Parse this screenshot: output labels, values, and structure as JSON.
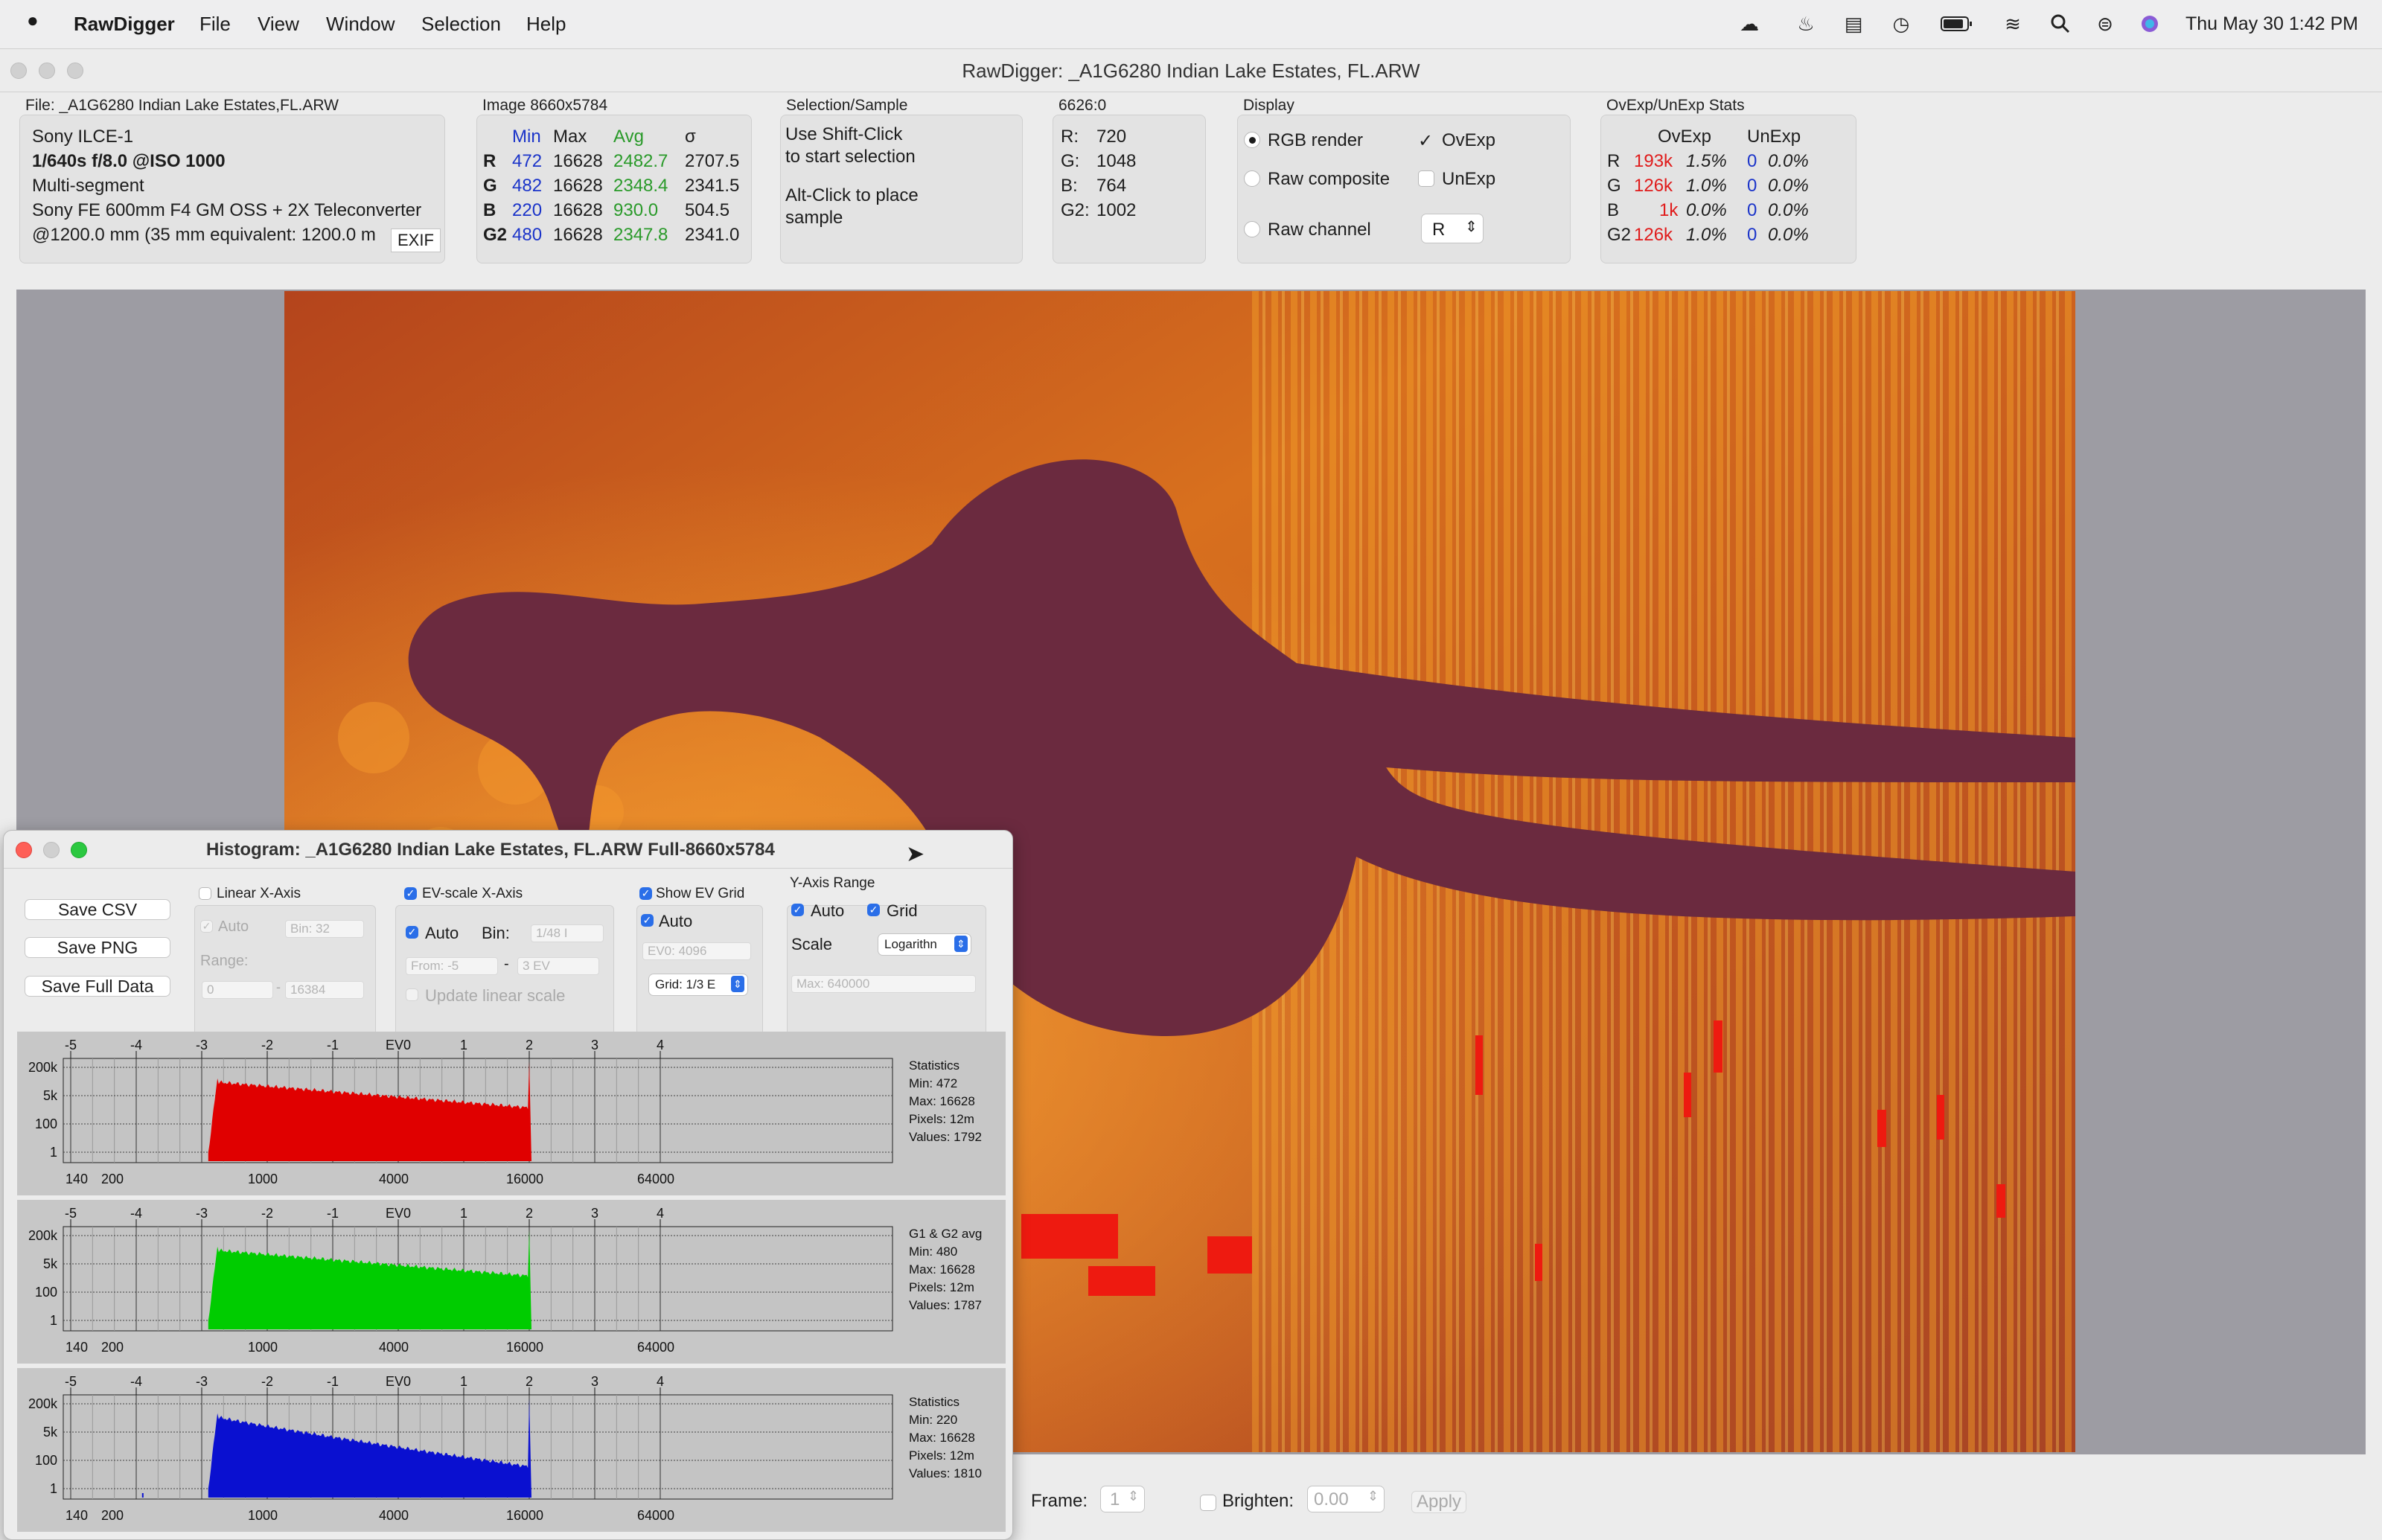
{
  "menubar": {
    "app": "RawDigger",
    "items": [
      "File",
      "View",
      "Window",
      "Selection",
      "Help"
    ],
    "clock": "Thu May 30  1:42 PM"
  },
  "window": {
    "title": "RawDigger: _A1G6280 Indian Lake Estates, FL.ARW"
  },
  "file": {
    "label": "File: _A1G6280 Indian Lake Estates,FL.ARW",
    "camera": "Sony ILCE-1",
    "exposure": "1/640s f/8.0 @ISO 1000",
    "mode": "Multi-segment",
    "lens": "Sony FE 600mm F4 GM OSS + 2X Teleconverter",
    "focal": "@1200.0 mm (35 mm equivalent: 1200.0 m",
    "exif": "EXIF"
  },
  "image": {
    "label": "Image 8660x5784",
    "headers": [
      "Min",
      "Max",
      "Avg",
      "σ"
    ],
    "rows": [
      {
        "ch": "R",
        "min": "472",
        "max": "16628",
        "avg": "2482.7",
        "sd": "2707.5"
      },
      {
        "ch": "G",
        "min": "482",
        "max": "16628",
        "avg": "2348.4",
        "sd": "2341.5"
      },
      {
        "ch": "B",
        "min": "220",
        "max": "16628",
        "avg": "930.0",
        "sd": "504.5"
      },
      {
        "ch": "G2",
        "min": "480",
        "max": "16628",
        "avg": "2347.8",
        "sd": "2341.0"
      }
    ]
  },
  "selection": {
    "label": "Selection/Sample",
    "line1": "Use Shift-Click",
    "line2": "to start selection",
    "line3": "Alt-Click to place",
    "line4": "sample"
  },
  "sample": {
    "label": "6626:0",
    "rows": [
      {
        "k": "R:",
        "v": "720"
      },
      {
        "k": "G:",
        "v": "1048"
      },
      {
        "k": "B:",
        "v": "764"
      },
      {
        "k": "G2:",
        "v": "1002"
      }
    ]
  },
  "display": {
    "label": "Display",
    "rgb": "RGB render",
    "rawcomp": "Raw composite",
    "rawch": "Raw channel",
    "ovexp": "OvExp",
    "unexp": "UnExp",
    "channel": "R"
  },
  "stats": {
    "label": "OvExp/UnExp Stats",
    "h1": "OvExp",
    "h2": "UnExp",
    "rows": [
      {
        "ch": "R",
        "ov": "193k",
        "ovp": "1.5%",
        "un": "0",
        "unp": "0.0%"
      },
      {
        "ch": "G",
        "ov": "126k",
        "ovp": "1.0%",
        "un": "0",
        "unp": "0.0%"
      },
      {
        "ch": "B",
        "ov": "1k",
        "ovp": "0.0%",
        "un": "0",
        "unp": "0.0%"
      },
      {
        "ch": "G2",
        "ov": "126k",
        "ovp": "1.0%",
        "un": "0",
        "unp": "0.0%"
      }
    ]
  },
  "bottom": {
    "frame": "Frame:",
    "frame_val": "1",
    "brighten": "Brighten:",
    "brighten_val": "0.00",
    "apply": "Apply"
  },
  "histogram": {
    "title": "Histogram: _A1G6280 Indian Lake Estates, FL.ARW Full-8660x5784",
    "save_csv": "Save CSV",
    "save_png": "Save PNG",
    "save_full": "Save Full Data",
    "linear": "Linear X-Axis",
    "auto": "Auto",
    "bin_ph": "Bin: 32",
    "range": "Range:",
    "r0": "0",
    "r1": "16384",
    "ev": "EV-scale X-Axis",
    "bin": "Bin:",
    "bin_val": "1/48 I",
    "from": "From: -5",
    "to": "3 EV",
    "update": "Update linear scale",
    "showev": "Show EV Grid",
    "ev0": "EV0: 4096",
    "grid_sel": "Grid: 1/3 E",
    "yrange": "Y-Axis Range",
    "grid": "Grid",
    "scale": "Scale",
    "scale_val": "Logarithn",
    "max": "Max: 640000",
    "ev_ticks": [
      "-5",
      "-4",
      "-3",
      "-2",
      "-1",
      "EV0",
      "1",
      "2",
      "3",
      "4"
    ],
    "x_ticks": [
      "140",
      "200",
      "1000",
      "4000",
      "16000",
      "64000"
    ],
    "y_ticks": [
      "200k",
      "5k",
      "100",
      "1"
    ],
    "panels": [
      {
        "color": "#e00000",
        "stats": [
          "Statistics",
          "Min: 472",
          "Max: 16628",
          "Pixels: 12m",
          "Values: 1792"
        ]
      },
      {
        "color": "#00cc00",
        "stats": [
          "G1 & G2 avg",
          "Min: 480",
          "Max: 16628",
          "Pixels: 12m",
          "Values: 1787"
        ]
      },
      {
        "color": "#0a10d0",
        "stats": [
          "Statistics",
          "Min: 220",
          "Max: 16628",
          "Pixels: 12m",
          "Values: 1810"
        ]
      }
    ]
  }
}
